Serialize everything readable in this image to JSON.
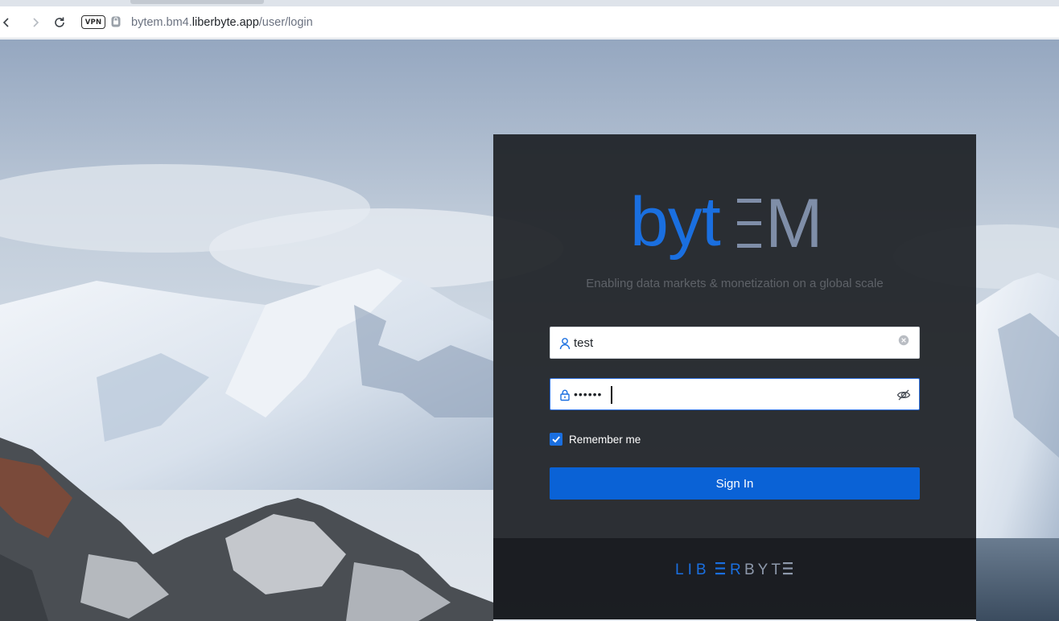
{
  "browser": {
    "badge": "VPN",
    "url_host_prefix": "bytem.bm4.",
    "url_host": "liberbyte.app",
    "url_path": "/user/login"
  },
  "login": {
    "logo_text_left": "byt",
    "logo_text_right": "M",
    "tagline": "Enabling data markets & monetization on a global scale",
    "username_value": "test",
    "password_value": "••••••",
    "remember_label": "Remember me",
    "remember_checked": true,
    "signin_label": "Sign In",
    "footer_brand_left": "LIB",
    "footer_brand_mid": "R",
    "footer_brand_right": "BYT"
  },
  "colors": {
    "brand_blue": "#0a62d6",
    "logo_blue": "#1a6fe0",
    "logo_gray": "#7f8ea8",
    "panel_bg": "#1e2126"
  },
  "icons": {
    "back": "chevron-left-icon",
    "forward": "chevron-right-icon",
    "reload": "reload-icon",
    "lock": "lock-icon",
    "user": "user-icon",
    "clear": "clear-icon",
    "password": "password-lock-icon",
    "visibility": "eye-off-icon",
    "check": "check-icon"
  }
}
